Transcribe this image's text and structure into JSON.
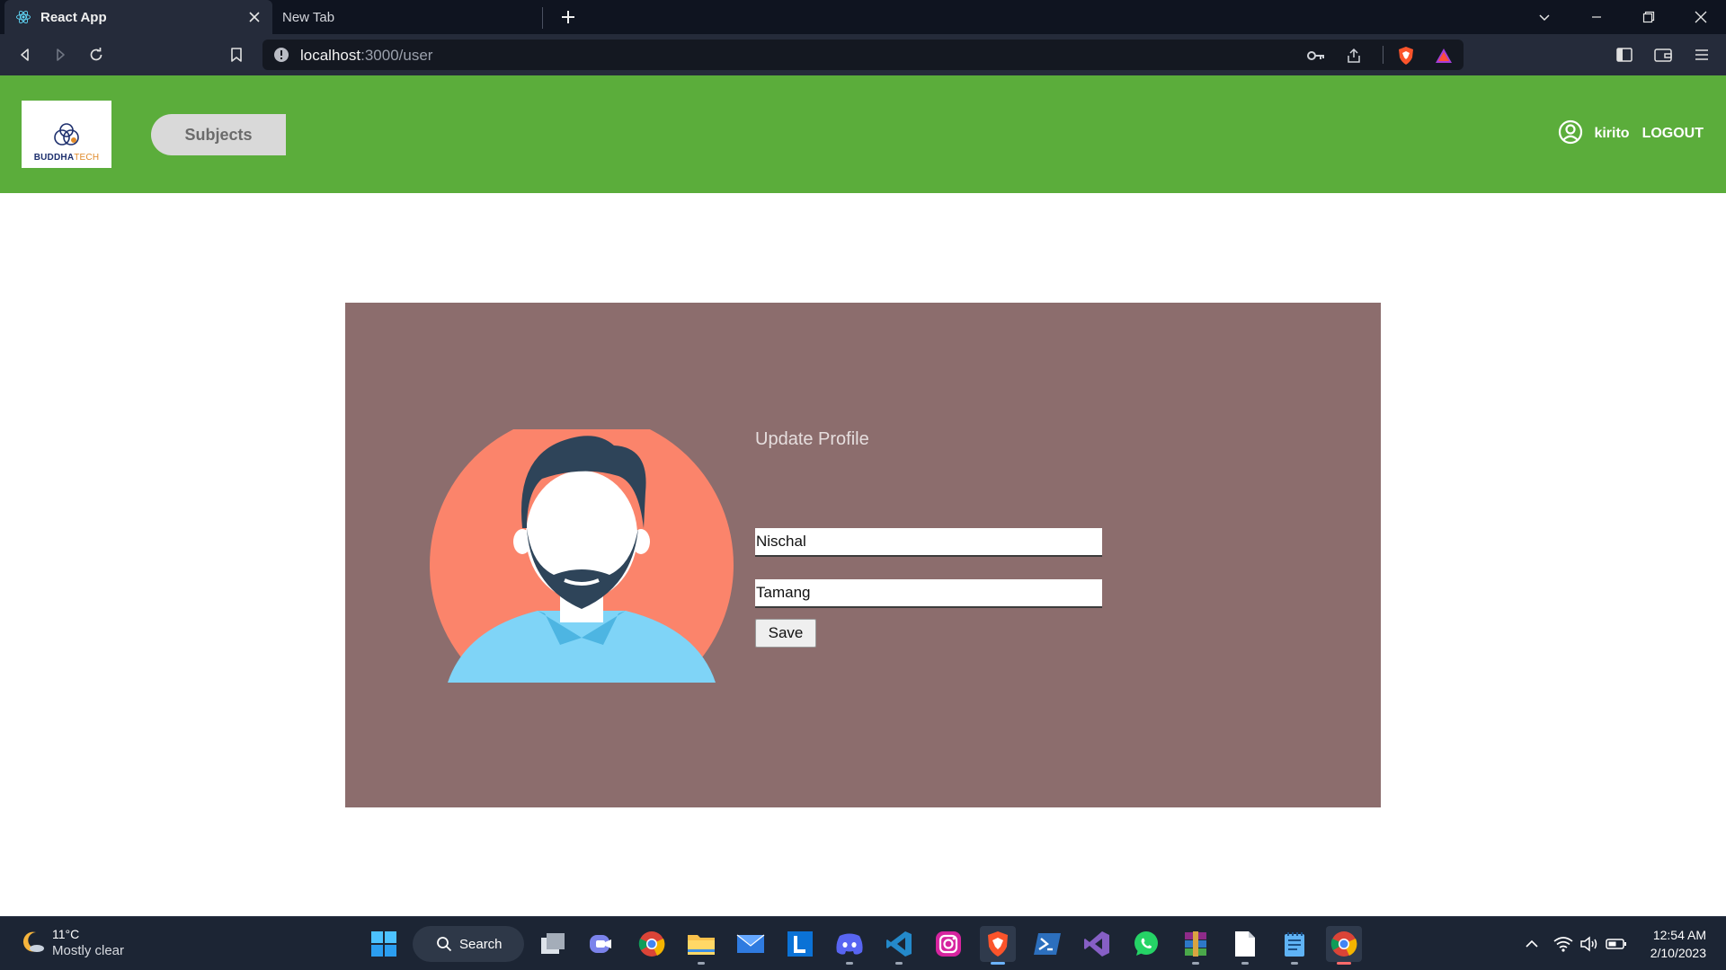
{
  "browser": {
    "tabs": [
      {
        "title": "React App",
        "active": true
      },
      {
        "title": "New Tab",
        "active": false
      }
    ],
    "url_host": "localhost",
    "url_path": ":3000/user"
  },
  "header": {
    "logo_text_main": "BUDDHA",
    "logo_text_accent": "TECH",
    "nav_button": "Subjects",
    "username": "kirito",
    "logout": "LOGOUT"
  },
  "profile": {
    "title": "Update Profile",
    "first_name": "Nischal",
    "last_name": "Tamang",
    "save_label": "Save"
  },
  "colors": {
    "header_green": "#5bad3b",
    "card_bg": "#8c6d6d",
    "avatar_circle": "#fb846b",
    "avatar_hair": "#2e4459",
    "avatar_shirt": "#7fd4f7"
  },
  "taskbar": {
    "weather_temp": "11°C",
    "weather_condition": "Mostly clear",
    "search_label": "Search",
    "time": "12:54 AM",
    "date": "2/10/2023"
  }
}
